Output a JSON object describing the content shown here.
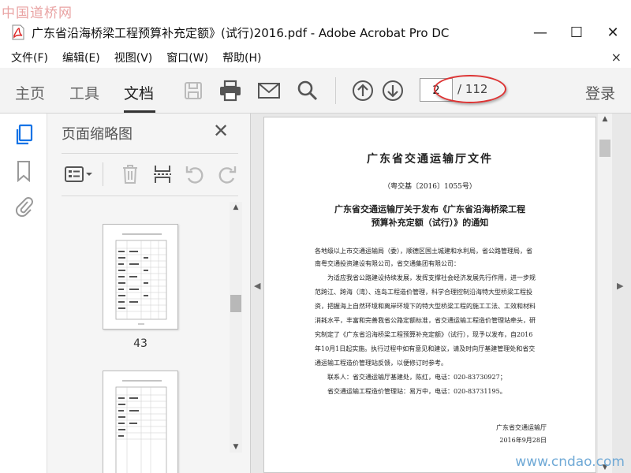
{
  "watermark": {
    "top": "中国道桥网",
    "bottom": "www.cndao.com"
  },
  "window": {
    "title": "广东省沿海桥梁工程预算补充定额》(试行)2016.pdf - Adobe Acrobat Pro DC",
    "minimize": "—",
    "maximize": "☐",
    "close": "✕"
  },
  "menu": {
    "items": [
      "文件(F)",
      "编辑(E)",
      "视图(V)",
      "窗口(W)",
      "帮助(H)"
    ],
    "close": "×"
  },
  "toolbar": {
    "tabs": [
      "主页",
      "工具",
      "文档"
    ],
    "active_tab": "文档",
    "page_input": "2",
    "page_total": "/ 112",
    "login": "登录"
  },
  "panel": {
    "title": "页面缩略图",
    "close": "✕",
    "thumbs": [
      {
        "label": "43"
      },
      {
        "label": ""
      }
    ]
  },
  "document": {
    "title": "广东省交通运输厅文件",
    "ref": "（粤交基〔2016〕1055号）",
    "heading_1": "广东省交通运输厅关于发布《广东省沿海桥梁工程",
    "heading_2": "预算补充定额（试行）》的通知",
    "lines": [
      "各地级以上市交通运输局（委），顺德区国土城建和水利局，省公路管理局，省",
      "南粤交通投资建设有限公司，省交通集团有限公司：",
      "　　为适应我省公路建设持续发展，发挥支撑社会经济发展先行作用，进一步规",
      "范跨江、跨海（湾）、连岛工程造价管理，科学合理控制沿海特大型桥梁工程投",
      "资，把握海上自然环境和离岸环境下的特大型桥梁工程的施工工法、工效和材料",
      "消耗水平，丰富和完善我省公路定额标准，省交通运输工程造价管理站牵头，研",
      "究制定了《广东省沿海桥梁工程预算补充定额》（试行），现予以发布，自2016",
      "年10月1日起实施。执行过程中如有意见和建议，请及时向厅基建管理处和省交",
      "通运输工程造价管理站反馈，以便修订时参考。",
      "　　联系人：省交通运输厅基建处，陈红，电话：020-83730927；",
      "　　省交通运输工程造价管理站：易万中，电话：020-83731195。"
    ],
    "sign_org": "广东省交通运输厅",
    "sign_date": "2016年9月28日"
  }
}
